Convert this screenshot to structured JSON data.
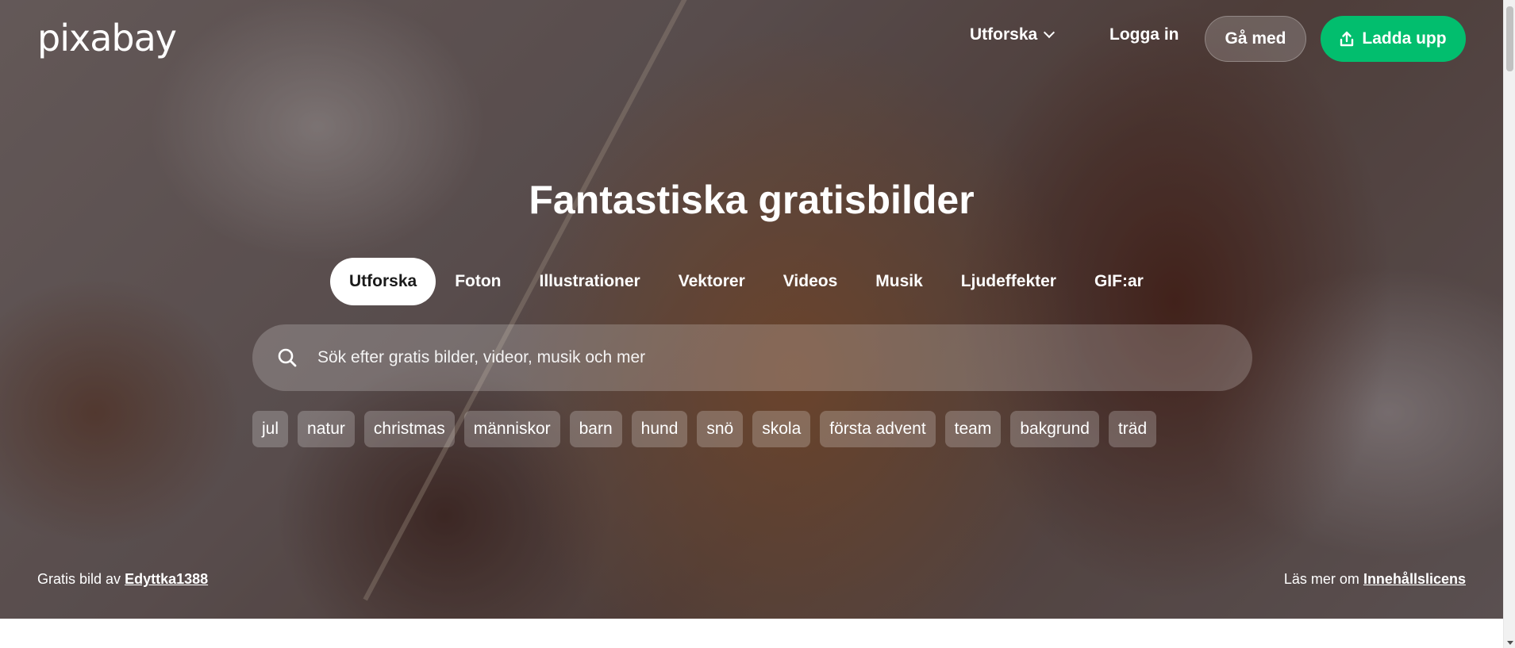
{
  "header": {
    "logo": "pixabay",
    "explore_label": "Utforska",
    "login_label": "Logga in",
    "join_label": "Gå med",
    "upload_label": "Ladda upp"
  },
  "hero": {
    "title": "Fantastiska gratisbilder"
  },
  "tabs": [
    {
      "label": "Utforska",
      "active": true
    },
    {
      "label": "Foton"
    },
    {
      "label": "Illustrationer"
    },
    {
      "label": "Vektorer"
    },
    {
      "label": "Videos"
    },
    {
      "label": "Musik"
    },
    {
      "label": "Ljudeffekter"
    },
    {
      "label": "GIF:ar"
    }
  ],
  "search": {
    "placeholder": "Sök efter gratis bilder, videor, musik och mer",
    "value": ""
  },
  "tags": [
    "jul",
    "natur",
    "christmas",
    "människor",
    "barn",
    "hund",
    "snö",
    "skola",
    "första advent",
    "team",
    "bakgrund",
    "träd"
  ],
  "credits": {
    "left_prefix": "Gratis bild av",
    "author": "Edyttka1388",
    "right_prefix": "Läs mer om",
    "license_link": "Innehållslicens"
  },
  "colors": {
    "accent_green": "#02be6e",
    "text_light": "#ffffff"
  },
  "icons": {
    "search": "search-icon",
    "upload": "upload-icon",
    "chevron": "chevron-down-icon"
  }
}
